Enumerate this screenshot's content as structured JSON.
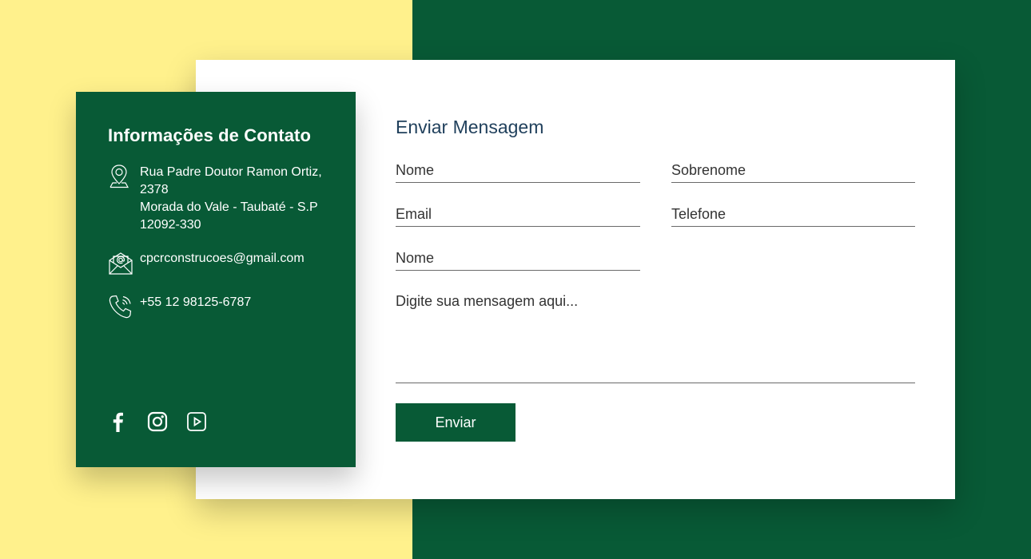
{
  "colors": {
    "yellow_background": "#fff18c",
    "green_brand": "#085a36",
    "card_background": "#ffffff",
    "title_text": "#1f3f5b"
  },
  "contact_info": {
    "title": "Informações de Contato",
    "address_lines": [
      "Rua Padre Doutor Ramon Ortiz,",
      "2378",
      "Morada do Vale - Taubaté - S.P",
      "12092-330"
    ],
    "email": "cpcrconstrucoes@gmail.com",
    "phone": "+55 12 98125-6787",
    "icons": {
      "address": "location-pin-icon",
      "email": "envelope-at-icon",
      "phone": "phone-icon"
    },
    "social": [
      {
        "name": "facebook",
        "icon": "facebook-icon"
      },
      {
        "name": "instagram",
        "icon": "instagram-icon"
      },
      {
        "name": "youtube",
        "icon": "youtube-play-icon"
      }
    ]
  },
  "form": {
    "title": "Enviar Mensagem",
    "fields": {
      "first_name": {
        "placeholder": "Nome",
        "value": ""
      },
      "last_name": {
        "placeholder": "Sobrenome",
        "value": ""
      },
      "email": {
        "placeholder": "Email",
        "value": ""
      },
      "phone": {
        "placeholder": "Telefone",
        "value": ""
      },
      "name_extra": {
        "placeholder": "Nome",
        "value": ""
      },
      "message": {
        "placeholder": "Digite sua mensagem aqui...",
        "value": ""
      }
    },
    "submit_label": "Enviar"
  }
}
